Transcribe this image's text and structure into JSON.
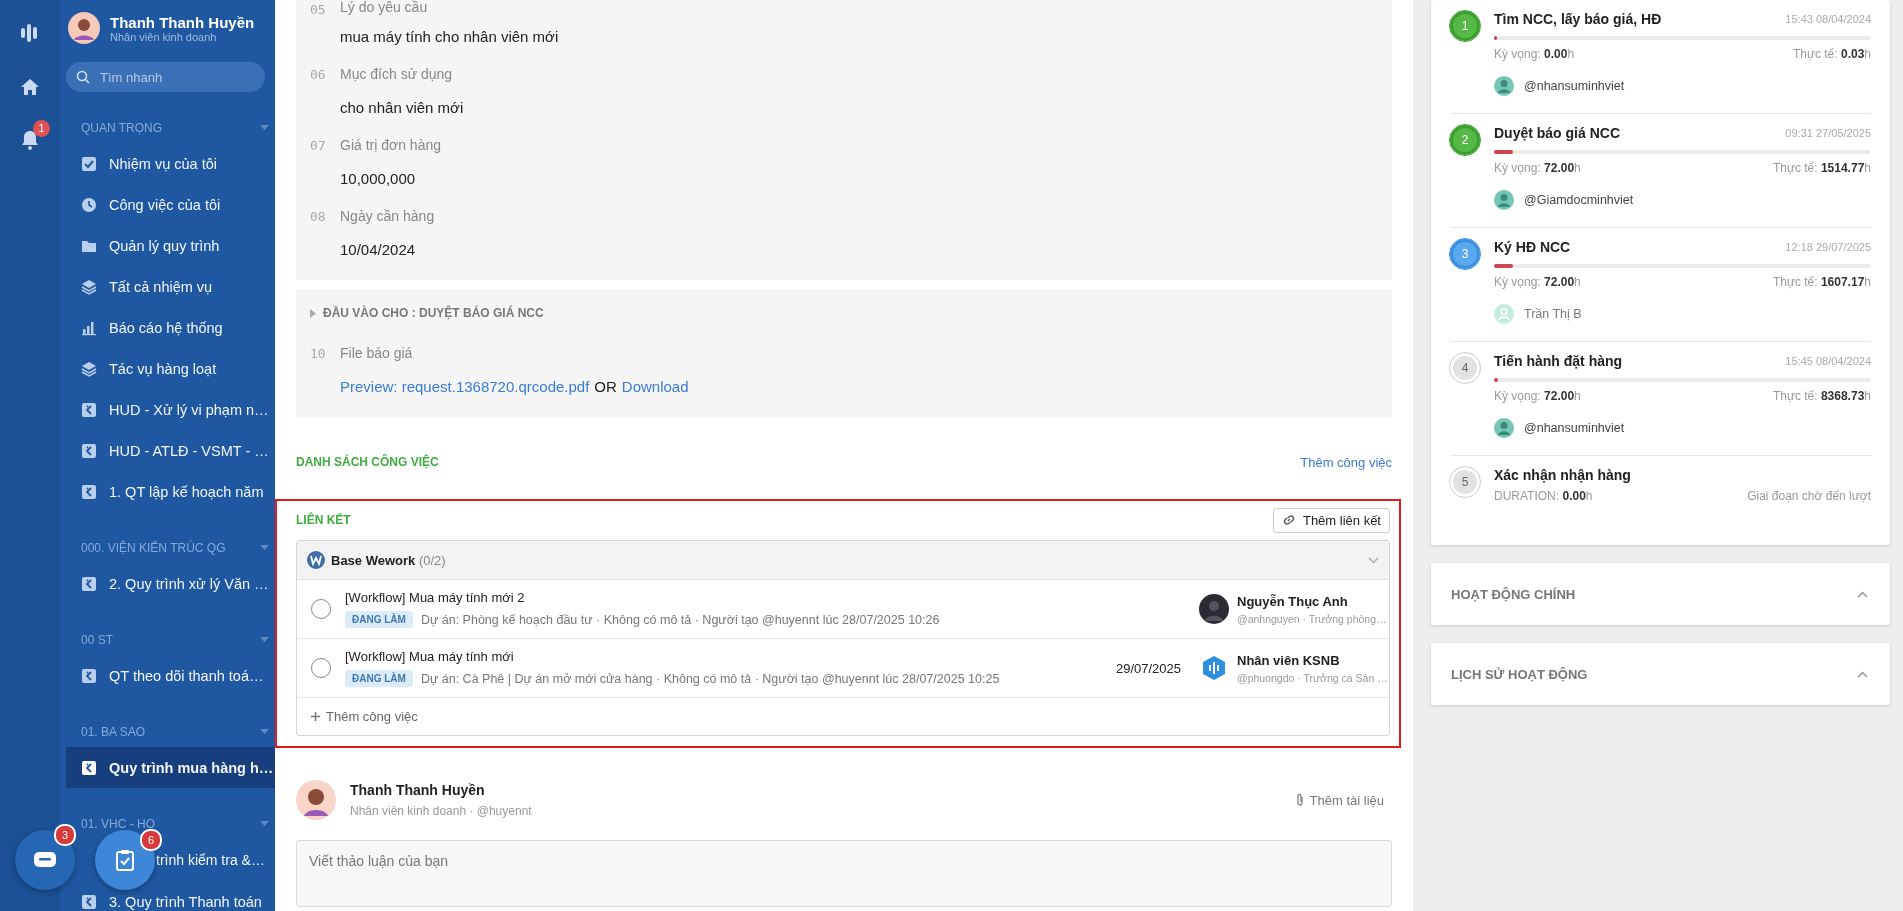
{
  "user": {
    "name": "Thanh Thanh Huyền",
    "role": "Nhân viên kinh doanh"
  },
  "rail": {
    "notification_count": "1"
  },
  "search": {
    "placeholder": "Tìm nhanh"
  },
  "sidebar_groups": [
    {
      "title": "QUAN TRỌNG",
      "items": [
        {
          "label": "Nhiệm vụ của tôi",
          "kind": "check",
          "selected": false
        },
        {
          "label": "Công việc của tôi",
          "kind": "clock",
          "selected": false
        },
        {
          "label": "Quản lý quy trình",
          "kind": "folder",
          "selected": false
        },
        {
          "label": "Tất cả nhiệm vụ",
          "kind": "layers",
          "selected": false
        },
        {
          "label": "Báo cáo hệ thống",
          "kind": "chart",
          "selected": false
        },
        {
          "label": "Tác vụ hàng loạt",
          "kind": "layers",
          "selected": false
        },
        {
          "label": "HUD - Xử lý vi phạm n…",
          "kind": "process",
          "selected": false
        },
        {
          "label": "HUD - ATLĐ - VSMT - …",
          "kind": "process",
          "selected": false
        },
        {
          "label": "1. QT lập kế hoạch năm",
          "kind": "process",
          "selected": false
        }
      ]
    },
    {
      "title": "000. VIỆN KIẾN TRÚC QG",
      "items": [
        {
          "label": "2. Quy trình xử lý Văn …",
          "kind": "process",
          "selected": false
        }
      ]
    },
    {
      "title": "00 ST",
      "items": [
        {
          "label": "QT theo dõi thanh toá…",
          "kind": "process",
          "selected": false
        }
      ]
    },
    {
      "title": "01. BA SAO",
      "items": [
        {
          "label": "Quy trình mua hàng h…",
          "kind": "process",
          "selected": true
        }
      ]
    },
    {
      "title": "01. VHC - HO",
      "items": [
        {
          "label": "trình kiểm tra &…",
          "kind": "covered",
          "selected": false
        },
        {
          "label": "3. Quy trình Thanh toán",
          "kind": "process",
          "selected": false
        }
      ]
    }
  ],
  "floating": {
    "chat_count": "3",
    "tasks_count": "6"
  },
  "form_fields": [
    {
      "number": "05",
      "label": "Lý do yêu cầu",
      "value": "mua máy tính cho nhân viên mới"
    },
    {
      "number": "06",
      "label": "Mục đích sử dụng",
      "value": "cho nhân viên mới"
    },
    {
      "number": "07",
      "label": "Giá trị đơn hàng",
      "value": "10,000,000"
    },
    {
      "number": "08",
      "label": "Ngày cần hàng",
      "value": "10/04/2024"
    }
  ],
  "input_section": {
    "title": "ĐẦU VÀO CHO : DUYỆT BÁO GIÁ NCC",
    "number": "10",
    "label": "File báo giá",
    "value_parts": [
      {
        "text": "Preview: request.1368720.qrcode.pdf",
        "kind": "link"
      },
      {
        "text": "OR",
        "kind": "text"
      },
      {
        "text": "Download",
        "kind": "link"
      }
    ]
  },
  "task_list": {
    "title": "DANH SÁCH CÔNG VIỆC",
    "action": "Thêm công việc"
  },
  "links": {
    "title": "LIÊN KẾT",
    "action": "Thêm liên kết",
    "group": "**Base Wework** (0/2)",
    "tasks": [
      {
        "title": "[Workflow] Mua máy tính mới 2",
        "checked": false,
        "status": "ĐANG LÀM",
        "meta": "Dự án: Phòng kế hoạch đầu tư · Không có mô tả · Người tạo @huyennt lúc 28/07/2025 10:26",
        "assignee": {
          "name": "Nguyễn Thục Anh",
          "detail": "@anhnguyen · Trưởng phòng…",
          "kind": "photo"
        }
      },
      {
        "title": "[Workflow] Mua máy tính mới",
        "checked": false,
        "status": "ĐANG LÀM",
        "meta": "Dự án: Cà Phê | Dự án mở mới cửa hàng · Không có mô tả · Người tạo @huyennt lúc 28/07/2025 10:25",
        "due": "29/07/2025",
        "assignee": {
          "name": "Nhân viên KSNB",
          "detail": "@phuongdo · Trưởng ca Sản …",
          "kind": "logo"
        }
      }
    ],
    "add_task": "Thêm công việc"
  },
  "comment": {
    "author": "Thanh Thanh Huyền",
    "subtitle": "Nhân viên kinh doanh · @huyennt",
    "attach": "Thêm tài liệu",
    "placeholder": "Viết thảo luận của bạn"
  },
  "steps": [
    {
      "number": "1",
      "kind": "done",
      "title": "Tìm NCC, lấy báo giá, HĐ",
      "time": "15:43 08/04/2024",
      "level": 0.005,
      "expected": "Kỳ vọng: **0.00**h",
      "actual": "Thực tế: **0.03**h",
      "assignee": {
        "name": "@nhansuminhviet",
        "active": true
      }
    },
    {
      "number": "2",
      "kind": "done",
      "title": "Duyệt báo giá NCC",
      "time": "09:31 27/05/2025",
      "level": 0.05,
      "expected": "Kỳ vọng: **72.00**h",
      "actual": "Thực tế: **1514.77**h",
      "assignee": {
        "name": "@Giamdocminhviet",
        "active": true
      }
    },
    {
      "number": "3",
      "kind": "active",
      "title": "Ký HĐ NCC",
      "time": "12:18 29/07/2025",
      "level": 0.05,
      "expected": "Kỳ vọng: **72.00**h",
      "actual": "Thực tế: **1607.17**h",
      "assignee": {
        "name": "Trần Thị B",
        "active": false
      }
    },
    {
      "number": "4",
      "kind": "pending",
      "title": "Tiến hành đặt hàng",
      "time": "15:45 08/04/2024",
      "level": 0.01,
      "expected": "Kỳ vọng: **72.00**h",
      "actual": "Thực tế: **8368.73**h",
      "assignee": {
        "name": "@nhansuminhviet",
        "active": true
      }
    },
    {
      "number": "5",
      "kind": "pending",
      "title": "Xác nhận nhận hàng",
      "expected": "DURATION: **0.00**h",
      "note": "Giai đoạn chờ đến lượt"
    }
  ],
  "panels": [
    {
      "title": "HOẠT ĐỘNG CHÍNH"
    },
    {
      "title": "LỊCH SỬ HOẠT ĐỘNG"
    }
  ]
}
